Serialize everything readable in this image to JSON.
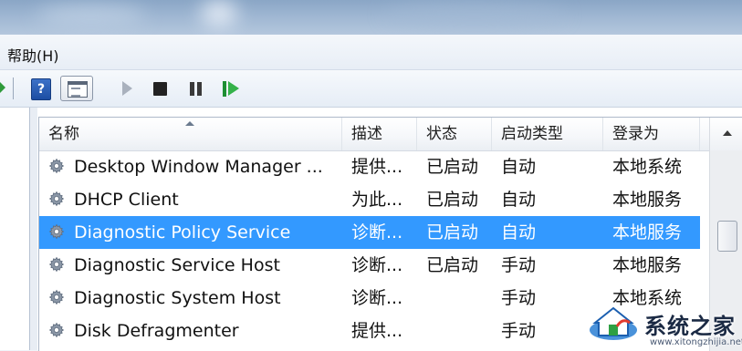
{
  "menubar": {
    "help_label": "帮助(H)"
  },
  "toolbar": {
    "help_glyph": "?",
    "buttons": [
      "help-icon",
      "properties-icon",
      "start-service-icon",
      "stop-service-icon",
      "pause-service-icon",
      "restart-service-icon"
    ]
  },
  "services": {
    "columns": {
      "name": "名称",
      "description": "描述",
      "status": "状态",
      "startup_type": "启动类型",
      "logon_as": "登录为"
    },
    "rows": [
      {
        "name": "Desktop Window Manager ...",
        "description": "提供...",
        "status": "已启动",
        "startup_type": "自动",
        "logon_as": "本地系统",
        "selected": false
      },
      {
        "name": "DHCP Client",
        "description": "为此...",
        "status": "已启动",
        "startup_type": "自动",
        "logon_as": "本地服务",
        "selected": false
      },
      {
        "name": "Diagnostic Policy Service",
        "description": "诊断...",
        "status": "已启动",
        "startup_type": "自动",
        "logon_as": "本地服务",
        "selected": true
      },
      {
        "name": "Diagnostic Service Host",
        "description": "诊断...",
        "status": "已启动",
        "startup_type": "手动",
        "logon_as": "本地服务",
        "selected": false
      },
      {
        "name": "Diagnostic System Host",
        "description": "诊断...",
        "status": "",
        "startup_type": "手动",
        "logon_as": "本地系统",
        "selected": false
      },
      {
        "name": "Disk Defragmenter",
        "description": "提供...",
        "status": "",
        "startup_type": "手动",
        "logon_as": "",
        "selected": false
      }
    ]
  },
  "watermark": {
    "name": "系统之家",
    "url": "www.xitongzhijia.net"
  },
  "colors": {
    "selection": "#3399ff",
    "accent_green": "#35b24a"
  }
}
